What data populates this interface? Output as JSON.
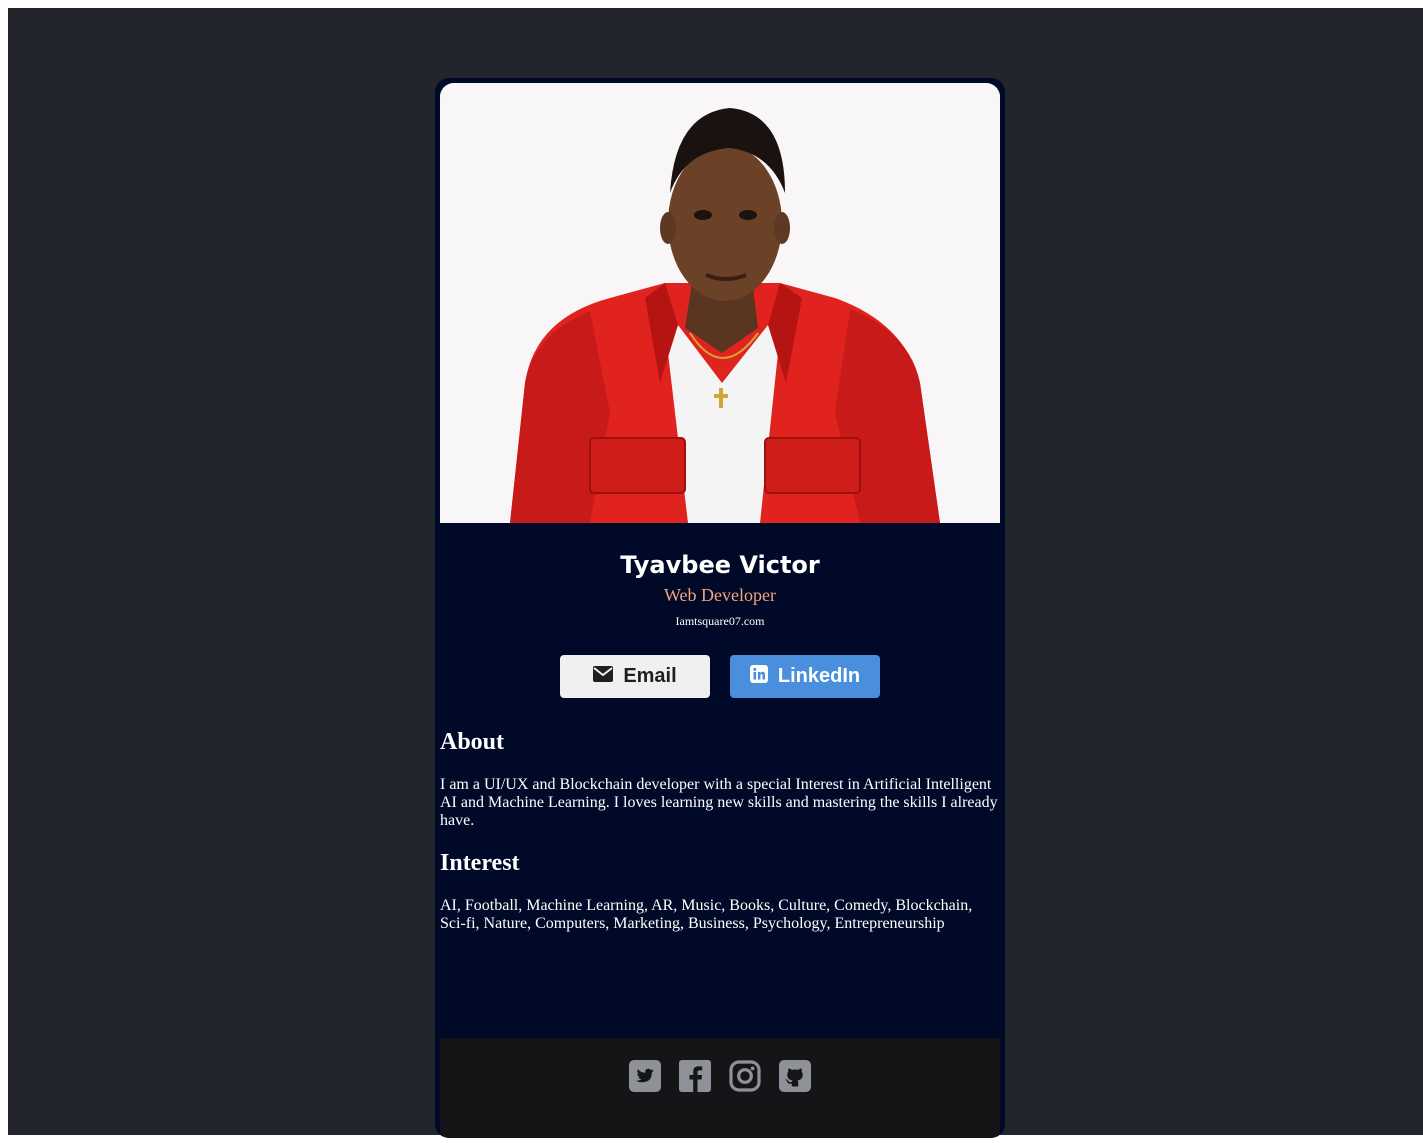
{
  "profile": {
    "name": "Tyavbee Victor",
    "title": "Web Developer",
    "website": "Iamtsquare07.com"
  },
  "buttons": {
    "email_label": "Email",
    "linkedin_label": "LinkedIn"
  },
  "about": {
    "heading": "About",
    "text": "I am a UI/UX and Blockchain developer with a special Interest in Artificial Intelligent AI and Machine Learning. I loves learning new skills and mastering the skills I already have."
  },
  "interest": {
    "heading": "Interest",
    "text": "AI, Football, Machine Learning, AR, Music, Books, Culture, Comedy, Blockchain, Sci-fi, Nature, Computers, Marketing, Business, Psychology, Entrepreneurship"
  },
  "footer": {
    "icons": [
      "twitter-icon",
      "facebook-icon",
      "instagram-icon",
      "github-icon"
    ]
  },
  "colors": {
    "background": "#23252c",
    "card": "#000a28",
    "accent_title": "#f3a27a",
    "linkedin": "#4a8fde",
    "footer": "#151517"
  }
}
